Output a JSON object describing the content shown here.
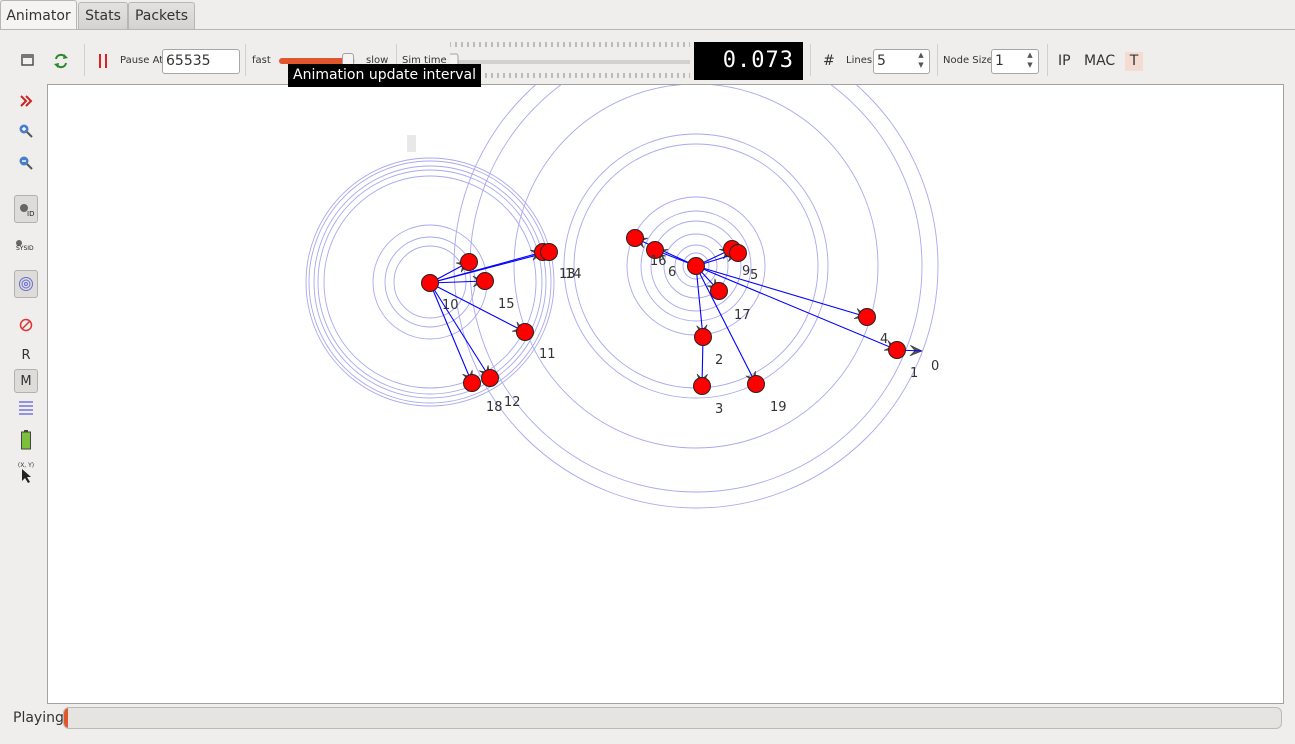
{
  "tabs": [
    {
      "label": "Animator",
      "active": true
    },
    {
      "label": "Stats",
      "active": false
    },
    {
      "label": "Packets",
      "active": false
    }
  ],
  "toolbar": {
    "pause_at_label": "Pause At",
    "pause_at_value": "65535",
    "fast_label": "fast",
    "slow_label": "slow",
    "sim_time_label": "Sim time",
    "sim_time_display": "0.073",
    "lines_label": "Lines",
    "lines_value": "5",
    "node_size_label": "Node Size",
    "node_size_value": "1",
    "ip_label": "IP",
    "mac_label": "MAC",
    "t_label": "T",
    "update_interval_level": 0.95
  },
  "tooltip": {
    "text": "Animation update interval"
  },
  "left_toolbar": {
    "r_label": "R",
    "m_label": "M",
    "sysid_label": "SYSID",
    "xy_label": "(X, Y)"
  },
  "colors": {
    "node_fill": "#ff0000",
    "packet_line": "#0000ff",
    "range_circle": "#a8a8f0",
    "accent": "#e2562e"
  },
  "nodes": [
    {
      "id": "0"
    },
    {
      "id": "1"
    },
    {
      "id": "2"
    },
    {
      "id": "3"
    },
    {
      "id": "4"
    },
    {
      "id": "5"
    },
    {
      "id": "6"
    },
    {
      "id": "9"
    },
    {
      "id": "10"
    },
    {
      "id": "11"
    },
    {
      "id": "12"
    },
    {
      "id": "13"
    },
    {
      "id": "14"
    },
    {
      "id": "15"
    },
    {
      "id": "16"
    },
    {
      "id": "17"
    },
    {
      "id": "18"
    },
    {
      "id": "19"
    }
  ],
  "status": {
    "label": "Playing",
    "progress": 0.003
  }
}
